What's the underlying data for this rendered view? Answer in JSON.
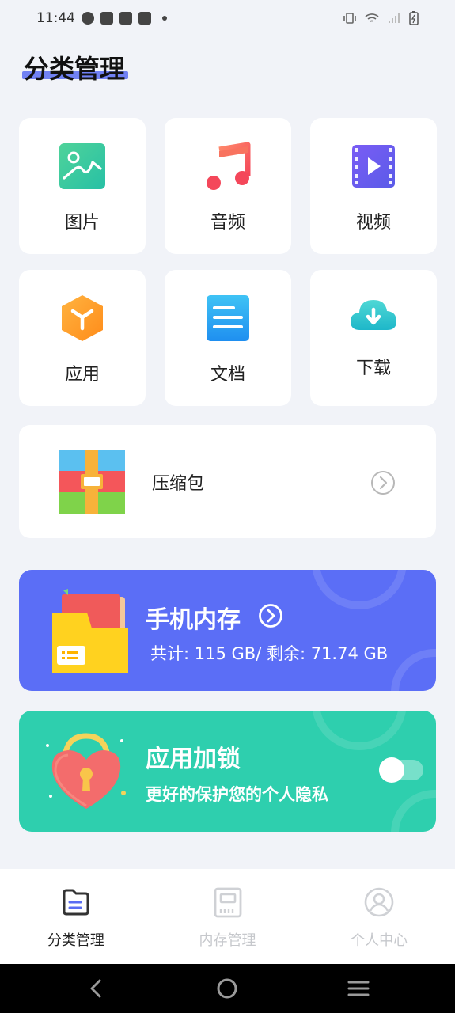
{
  "status_bar": {
    "time": "11:44"
  },
  "page": {
    "title": "分类管理"
  },
  "categories": [
    {
      "label": "图片",
      "icon": "image-icon"
    },
    {
      "label": "音频",
      "icon": "music-note-icon"
    },
    {
      "label": "视频",
      "icon": "video-icon"
    },
    {
      "label": "应用",
      "icon": "app-cube-icon"
    },
    {
      "label": "文档",
      "icon": "document-icon"
    },
    {
      "label": "下载",
      "icon": "cloud-download-icon"
    }
  ],
  "archive": {
    "label": "压缩包",
    "icon": "archive-box-icon"
  },
  "storage": {
    "title": "手机内存",
    "summary": "共计: 115 GB/ 剩余: 71.74 GB"
  },
  "app_lock": {
    "title": "应用加锁",
    "subtitle": "更好的保护您的个人隐私",
    "enabled": false
  },
  "bottom_nav": [
    {
      "label": "分类管理",
      "active": true
    },
    {
      "label": "内存管理",
      "active": false
    },
    {
      "label": "个人中心",
      "active": false
    }
  ],
  "colors": {
    "storage_card": "#5b6ef6",
    "lock_card": "#2ecfae",
    "accent_underline": "#5a6df3"
  }
}
